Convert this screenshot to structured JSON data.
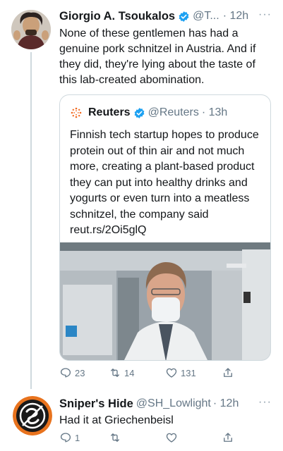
{
  "tweet1": {
    "name": "Giorgio A. Tsoukalos",
    "handle": "@T...",
    "time": "· 12h",
    "text": "None of these gentlemen has had a genuine pork schnitzel in Austria. And if they did, they're lying about the taste of this lab-created abomination.",
    "quote": {
      "name": "Reuters",
      "handle": "@Reuters",
      "time": "· 13h",
      "text": "Finnish tech startup hopes to produce protein out of thin air and not much more, creating a plant-based product they can put into healthy drinks and yogurts or even turn into a meatless schnitzel, the company said reut.rs/2Oi5glQ"
    },
    "replies": "23",
    "retweets": "14",
    "likes": "131"
  },
  "tweet2": {
    "name": "Sniper's Hide",
    "handle": "@SH_Lowlight",
    "time": "· 12h",
    "text": "Had it at Griechenbeisl",
    "replies": "1",
    "retweets": "",
    "likes": ""
  },
  "icons": {
    "verified": "verified-badge-icon",
    "reply": "reply-icon",
    "retweet": "retweet-icon",
    "like": "heart-icon",
    "share": "share-icon",
    "more": "more-dots-icon"
  },
  "colors": {
    "verified": "#1da1f2",
    "muted": "#657786",
    "border": "#cfd9de",
    "reuters_orange": "#f26a21",
    "avatar2_ring": "#e8731e"
  }
}
